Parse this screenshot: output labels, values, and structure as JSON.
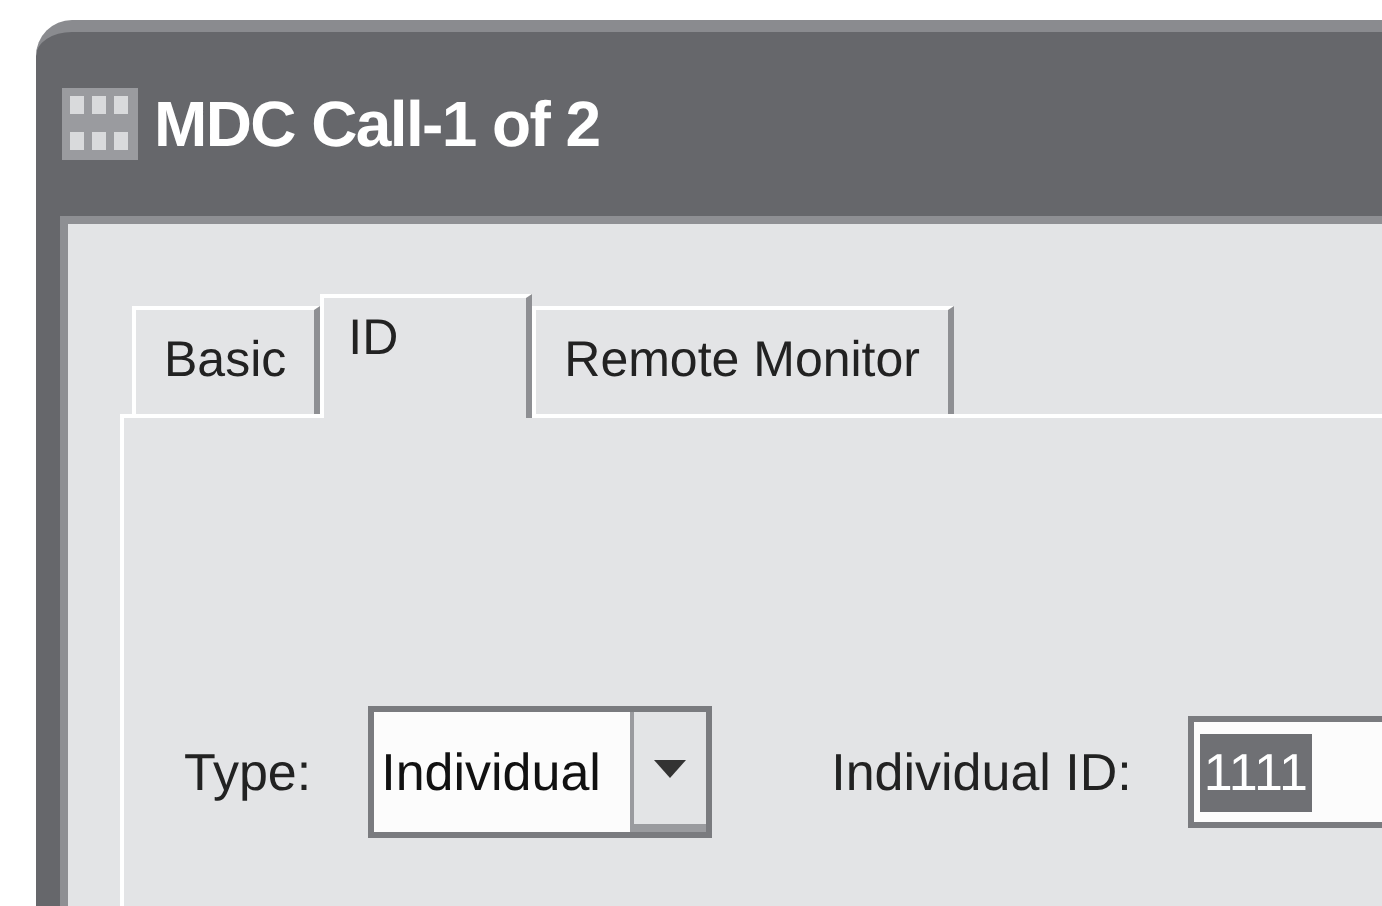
{
  "window": {
    "title": "MDC Call-1 of 2"
  },
  "tabs": [
    {
      "label": "Basic",
      "selected": false
    },
    {
      "label": "ID",
      "selected": true
    },
    {
      "label": "Remote Monitor",
      "selected": false
    }
  ],
  "type_field": {
    "label": "Type:",
    "value": "Individual"
  },
  "id_field": {
    "label": "Individual ID:",
    "value": "1111",
    "text_selected": true
  }
}
